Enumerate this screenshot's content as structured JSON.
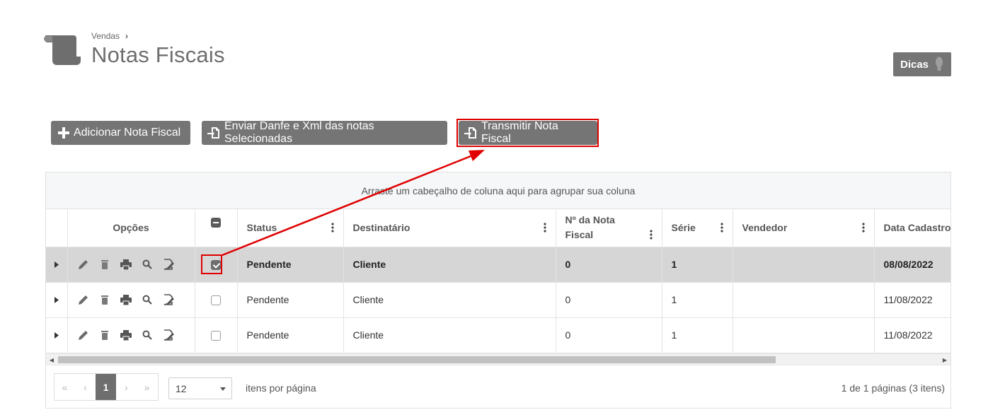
{
  "breadcrumb": {
    "parent": "Vendas",
    "separator": "›"
  },
  "page": {
    "title": "Notas Fiscais",
    "icon": "scroll-icon"
  },
  "tips_button": {
    "label": "Dicas",
    "icon": "lightbulb-icon"
  },
  "toolbar": {
    "add_label": "Adicionar Nota Fiscal",
    "send_label": "Enviar Danfe e Xml das notas Selecionadas",
    "transmit_label": "Transmitir Nota Fiscal"
  },
  "grid": {
    "group_hint": "Arraste um cabeçalho de coluna aqui para agrupar sua coluna",
    "columns": {
      "options": "Opções",
      "status": "Status",
      "recipient": "Destinatário",
      "invoice_number": "Nº da Nota Fiscal",
      "series": "Série",
      "seller": "Vendedor",
      "created_date": "Data Cadastro"
    },
    "rows": [
      {
        "selected": true,
        "status": "Pendente",
        "recipient": "Cliente",
        "invoice_number": "0",
        "series": "1",
        "seller": "",
        "created_date": "08/08/2022"
      },
      {
        "selected": false,
        "status": "Pendente",
        "recipient": "Cliente",
        "invoice_number": "0",
        "series": "1",
        "seller": "",
        "created_date": "11/08/2022"
      },
      {
        "selected": false,
        "status": "Pendente",
        "recipient": "Cliente",
        "invoice_number": "0",
        "series": "1",
        "seller": "",
        "created_date": "11/08/2022"
      }
    ]
  },
  "pager": {
    "first": "«",
    "prev": "‹",
    "current": "1",
    "next": "›",
    "last": "»",
    "page_size": "12",
    "page_size_label": "itens por página",
    "info": "1 de 1 páginas (3 itens)"
  },
  "colors": {
    "button_bg": "#757575",
    "annotation": "#e00000",
    "selected_row": "#d6d6d6"
  }
}
